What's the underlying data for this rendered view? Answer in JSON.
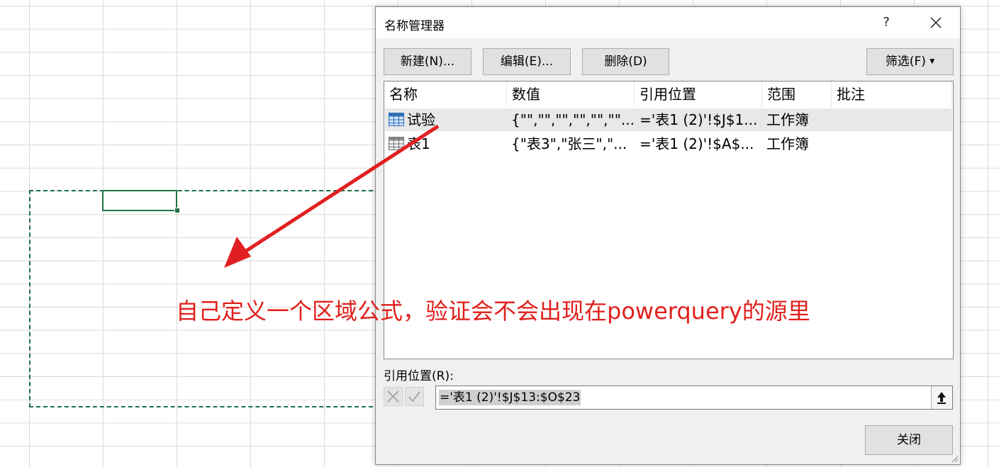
{
  "dialog": {
    "title": "名称管理器",
    "help": "?",
    "buttons": {
      "new": "新建(N)...",
      "edit": "编辑(E)...",
      "delete": "删除(D)",
      "filter": "筛选(F)",
      "close": "关闭"
    },
    "columns": [
      "名称",
      "数值",
      "引用位置",
      "范围",
      "批注"
    ],
    "rows": [
      {
        "name": "试验",
        "value": "{\"\",\"\",\"\",\"\",\"\",\"\"...",
        "refers_to": "='表1 (2)'!$J$1...",
        "scope": "工作簿",
        "comment": "",
        "icon": "named-range-icon"
      },
      {
        "name": "表1",
        "value": "{\"表3\",\"张三\",\"...",
        "refers_to": "='表1 (2)'!$A$...",
        "scope": "工作簿",
        "comment": "",
        "icon": "table-icon"
      }
    ],
    "ref_label": "引用位置(R):",
    "ref_value": "='表1 (2)'!$J$13:$O$23"
  },
  "annotation": {
    "text": "自己定义一个区域公式，验证会不会出现在powerquery的源里",
    "color": "#e0201c"
  },
  "colors": {
    "selection_border": "#217346",
    "dialog_bg": "#f0f0f0"
  }
}
